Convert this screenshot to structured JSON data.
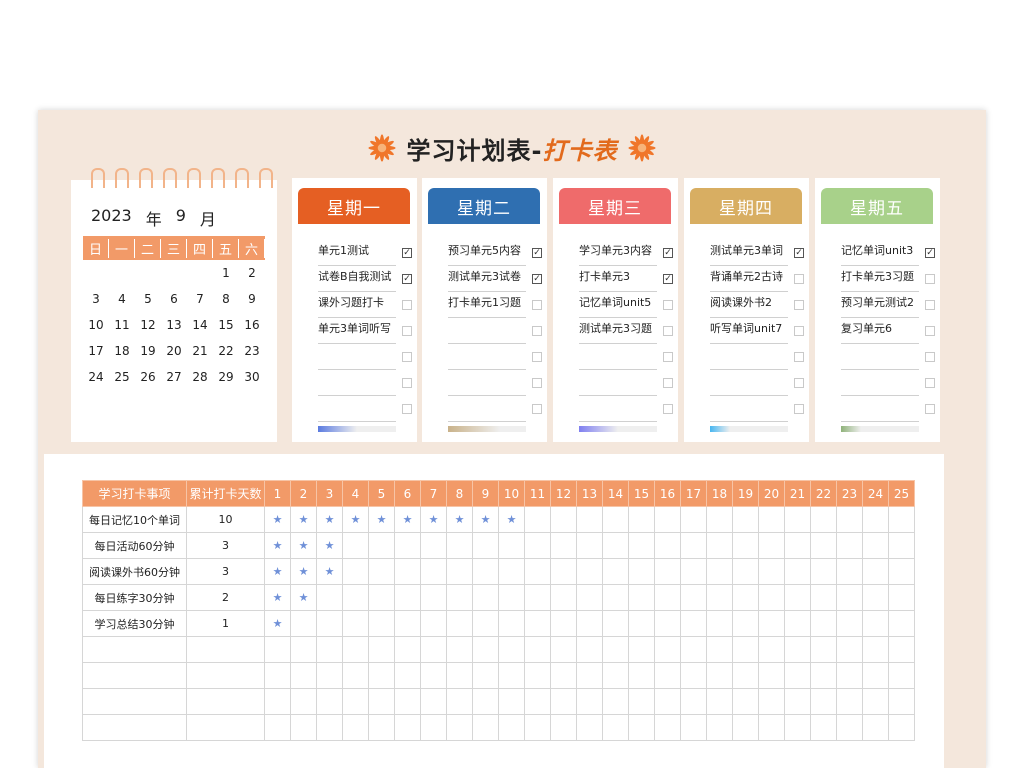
{
  "title": {
    "main": "学习计划表-",
    "highlight": "打卡表"
  },
  "calendar": {
    "year": "2023",
    "year_unit": "年",
    "month": "9",
    "month_unit": "月",
    "weekdays": [
      "日",
      "一",
      "二",
      "三",
      "四",
      "五",
      "六"
    ],
    "weeks": [
      [
        "",
        "",
        "",
        "",
        "",
        "1",
        "2"
      ],
      [
        "3",
        "4",
        "5",
        "6",
        "7",
        "8",
        "9"
      ],
      [
        "10",
        "11",
        "12",
        "13",
        "14",
        "15",
        "16"
      ],
      [
        "17",
        "18",
        "19",
        "20",
        "21",
        "22",
        "23"
      ],
      [
        "24",
        "25",
        "26",
        "27",
        "28",
        "29",
        "30"
      ]
    ]
  },
  "days": [
    {
      "name": "星期一",
      "color": "#e55f23",
      "progress_color": "#5b7be0",
      "progress": 0.5,
      "tasks": [
        {
          "text": "单元1测试",
          "done": true
        },
        {
          "text": "试卷B自我测试",
          "done": true
        },
        {
          "text": "课外习题打卡",
          "done": false
        },
        {
          "text": "单元3单词听写",
          "done": false
        },
        {
          "text": "",
          "done": false
        },
        {
          "text": "",
          "done": false
        },
        {
          "text": "",
          "done": false
        }
      ]
    },
    {
      "name": "星期二",
      "color": "#2f6fb1",
      "progress_color": "#c9b28a",
      "progress": 0.67,
      "tasks": [
        {
          "text": "预习单元5内容",
          "done": true
        },
        {
          "text": "测试单元3试卷",
          "done": true
        },
        {
          "text": "打卡单元1习题",
          "done": false
        },
        {
          "text": "",
          "done": false
        },
        {
          "text": "",
          "done": false
        },
        {
          "text": "",
          "done": false
        },
        {
          "text": "",
          "done": false
        }
      ]
    },
    {
      "name": "星期三",
      "color": "#ef6b6b",
      "progress_color": "#7f7ff0",
      "progress": 0.5,
      "tasks": [
        {
          "text": "学习单元3内容",
          "done": true
        },
        {
          "text": "打卡单元3",
          "done": true
        },
        {
          "text": "记忆单词unit5",
          "done": false
        },
        {
          "text": "测试单元3习题",
          "done": false
        },
        {
          "text": "",
          "done": false
        },
        {
          "text": "",
          "done": false
        },
        {
          "text": "",
          "done": false
        }
      ]
    },
    {
      "name": "星期四",
      "color": "#d8ae62",
      "progress_color": "#48b6f0",
      "progress": 0.25,
      "tasks": [
        {
          "text": "测试单元3单词",
          "done": true
        },
        {
          "text": "背诵单元2古诗",
          "done": false
        },
        {
          "text": "阅读课外书2",
          "done": false
        },
        {
          "text": "听写单词unit7",
          "done": false
        },
        {
          "text": "",
          "done": false
        },
        {
          "text": "",
          "done": false
        },
        {
          "text": "",
          "done": false
        }
      ]
    },
    {
      "name": "星期五",
      "color": "#a8d18a",
      "progress_color": "#8fb27a",
      "progress": 0.25,
      "tasks": [
        {
          "text": "记忆单词unit3",
          "done": true
        },
        {
          "text": "打卡单元3习题",
          "done": false
        },
        {
          "text": "预习单元测试2",
          "done": false
        },
        {
          "text": "复习单元6",
          "done": false
        },
        {
          "text": "",
          "done": false
        },
        {
          "text": "",
          "done": false
        },
        {
          "text": "",
          "done": false
        }
      ]
    }
  ],
  "tracker": {
    "col_item": "学习打卡事项",
    "col_total": "累计打卡天数",
    "day_numbers": [
      "1",
      "2",
      "3",
      "4",
      "5",
      "6",
      "7",
      "8",
      "9",
      "10",
      "11",
      "12",
      "13",
      "14",
      "15",
      "16",
      "17",
      "18",
      "19",
      "20",
      "21",
      "22",
      "23",
      "24",
      "25"
    ],
    "star": "★",
    "rows": [
      {
        "item": "每日记忆10个单词",
        "total": "10",
        "stars": 10
      },
      {
        "item": "每日活动60分钟",
        "total": "3",
        "stars": 3
      },
      {
        "item": "阅读课外书60分钟",
        "total": "3",
        "stars": 3
      },
      {
        "item": "每日练字30分钟",
        "total": "2",
        "stars": 2
      },
      {
        "item": "学习总结30分钟",
        "total": "1",
        "stars": 1
      },
      {
        "item": "",
        "total": "",
        "stars": 0
      },
      {
        "item": "",
        "total": "",
        "stars": 0
      },
      {
        "item": "",
        "total": "",
        "stars": 0
      },
      {
        "item": "",
        "total": "",
        "stars": 0
      }
    ]
  }
}
